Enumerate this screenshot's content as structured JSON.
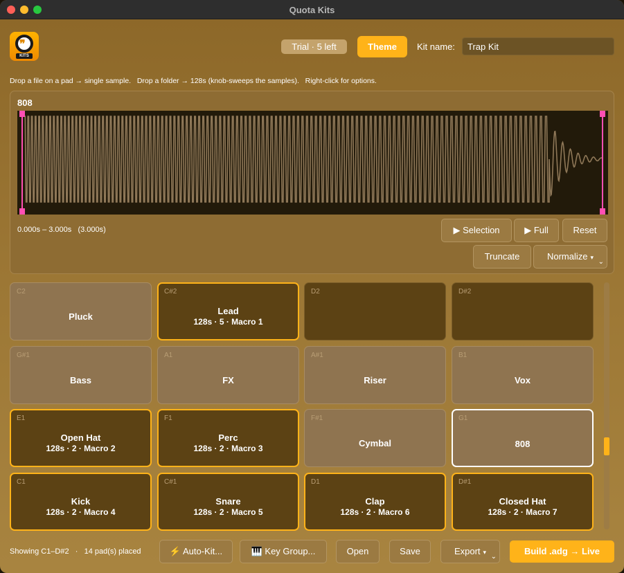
{
  "window": {
    "title": "Quota Kits"
  },
  "logo": {
    "glyph": "❞",
    "badge_text": "KITS"
  },
  "header": {
    "trial_badge": "Trial · 5 left",
    "theme_button": "Theme",
    "kit_name_label": "Kit name:",
    "kit_name_value": "Trap Kit"
  },
  "hint": "Drop a file on a pad → single sample.   Drop a folder → 128s (knob-sweeps the samples).   Right-click for options.",
  "waveform": {
    "sample_name": "808",
    "time_range": "0.000s – 3.000s   (3.000s)",
    "buttons": {
      "selection": "▶ Selection",
      "full": "▶ Full",
      "reset": "Reset",
      "truncate": "Truncate",
      "normalize": "Normalize",
      "normalize_chevron": "▾"
    },
    "colors": {
      "wave": "#8f7858",
      "marker": "#ff4fb3",
      "background": "#221a0a"
    }
  },
  "pads": [
    {
      "note": "C2",
      "name": "Pluck",
      "detail": "",
      "state": "filled"
    },
    {
      "note": "C#2",
      "name": "Lead",
      "detail": "128s · 5 · Macro 1",
      "state": "macro"
    },
    {
      "note": "D2",
      "name": "",
      "detail": "",
      "state": "empty"
    },
    {
      "note": "D#2",
      "name": "",
      "detail": "",
      "state": "empty"
    },
    {
      "note": "G#1",
      "name": "Bass",
      "detail": "",
      "state": "filled"
    },
    {
      "note": "A1",
      "name": "FX",
      "detail": "",
      "state": "filled"
    },
    {
      "note": "A#1",
      "name": "Riser",
      "detail": "",
      "state": "filled"
    },
    {
      "note": "B1",
      "name": "Vox",
      "detail": "",
      "state": "filled"
    },
    {
      "note": "E1",
      "name": "Open Hat",
      "detail": "128s · 2 · Macro 2",
      "state": "macro"
    },
    {
      "note": "F1",
      "name": "Perc",
      "detail": "128s · 2 · Macro 3",
      "state": "macro"
    },
    {
      "note": "F#1",
      "name": "Cymbal",
      "detail": "",
      "state": "filled"
    },
    {
      "note": "G1",
      "name": "808",
      "detail": "",
      "state": "selected"
    },
    {
      "note": "C1",
      "name": "Kick",
      "detail": "128s · 2 · Macro 4",
      "state": "macro"
    },
    {
      "note": "C#1",
      "name": "Snare",
      "detail": "128s · 2 · Macro 5",
      "state": "macro"
    },
    {
      "note": "D1",
      "name": "Clap",
      "detail": "128s · 2 · Macro 6",
      "state": "macro"
    },
    {
      "note": "D#1",
      "name": "Closed Hat",
      "detail": "128s · 2 · Macro 7",
      "state": "macro"
    }
  ],
  "footer": {
    "status": "Showing C1–D#2   ·   14 pad(s) placed",
    "auto_kit": "⚡ Auto-Kit...",
    "key_group": "🎹 Key Group...",
    "open": "Open",
    "save": "Save",
    "export": "Export",
    "export_chevron": "▾",
    "build": "Build .adg → Live"
  },
  "colors": {
    "accent": "#ffb319",
    "selected_border": "#ffffff"
  }
}
